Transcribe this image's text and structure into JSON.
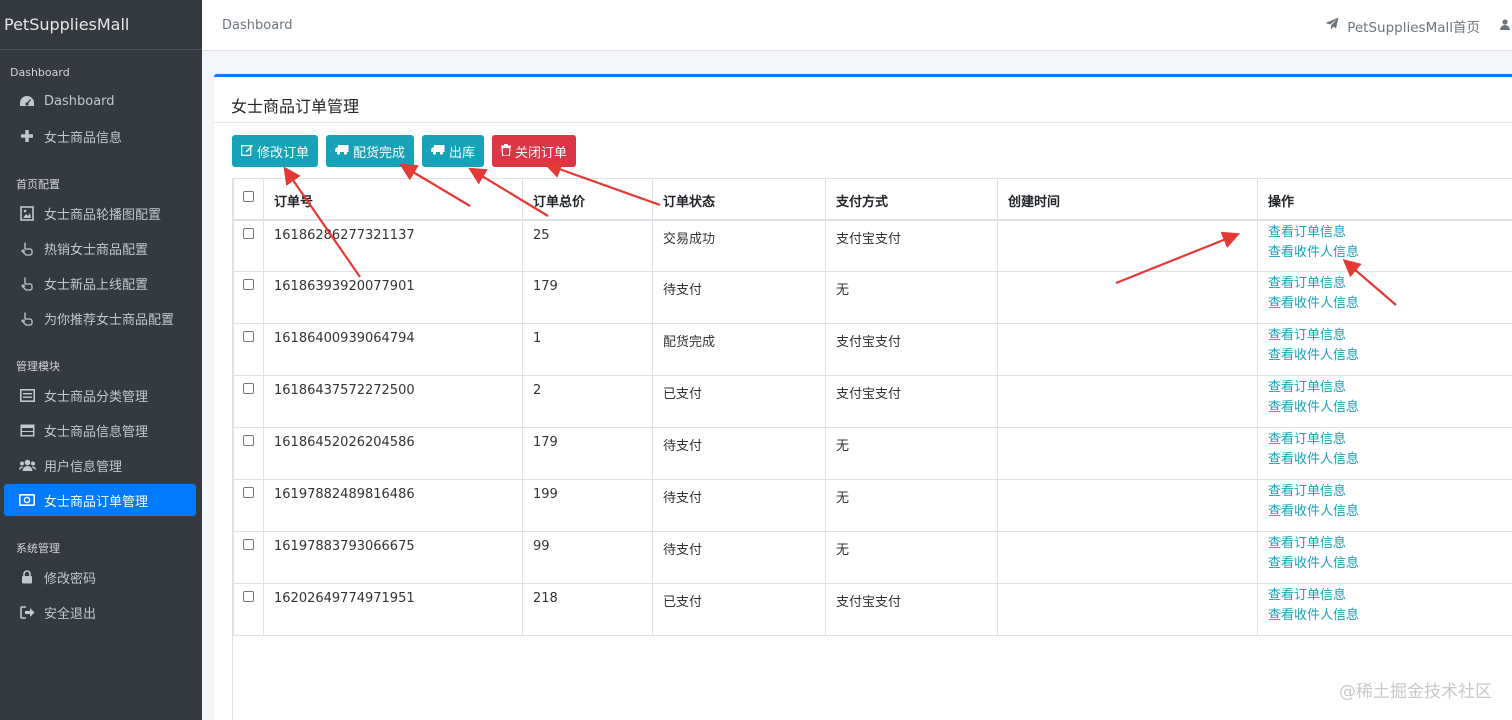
{
  "brand": "PetSuppliesMall",
  "sidebar": {
    "sections": [
      {
        "header": "Dashboard",
        "items": [
          {
            "label": "Dashboard",
            "icon": "tachometer-icon"
          },
          {
            "label": "女士商品信息",
            "icon": "plus-icon"
          }
        ]
      },
      {
        "header": "首页配置",
        "items": [
          {
            "label": "女士商品轮播图配置",
            "icon": "image-icon"
          },
          {
            "label": "热销女士商品配置",
            "icon": "hand-pointer-icon"
          },
          {
            "label": "女士新品上线配置",
            "icon": "hand-pointer-icon"
          },
          {
            "label": "为你推荐女士商品配置",
            "icon": "hand-pointer-icon"
          }
        ]
      },
      {
        "header": "管理模块",
        "items": [
          {
            "label": "女士商品分类管理",
            "icon": "list-alt-icon"
          },
          {
            "label": "女士商品信息管理",
            "icon": "table-icon"
          },
          {
            "label": "用户信息管理",
            "icon": "users-icon"
          },
          {
            "label": "女士商品订单管理",
            "icon": "money-bill-icon",
            "active": true
          }
        ]
      },
      {
        "header": "系统管理",
        "items": [
          {
            "label": "修改密码",
            "icon": "lock-icon"
          },
          {
            "label": "安全退出",
            "icon": "sign-out-icon"
          }
        ]
      }
    ]
  },
  "topbar": {
    "breadcrumb": "Dashboard",
    "home_link": "PetSuppliesMall首页"
  },
  "card": {
    "title": "女士商品订单管理",
    "buttons": {
      "edit": "修改订单",
      "delivered": "配货完成",
      "outbound": "出库",
      "close": "关闭订单"
    }
  },
  "table": {
    "headers": [
      "订单号",
      "订单总价",
      "订单状态",
      "支付方式",
      "创建时间",
      "操作"
    ],
    "op_view_order": "查看订单信息",
    "op_view_receiver": "查看收件人信息",
    "rows": [
      {
        "order_no": "16186286277321137",
        "total": "25",
        "status": "交易成功",
        "pay": "支付宝支付",
        "created": ""
      },
      {
        "order_no": "16186393920077901",
        "total": "179",
        "status": "待支付",
        "pay": "无",
        "created": ""
      },
      {
        "order_no": "16186400939064794",
        "total": "1",
        "status": "配货完成",
        "pay": "支付宝支付",
        "created": ""
      },
      {
        "order_no": "16186437572272500",
        "total": "2",
        "status": "已支付",
        "pay": "支付宝支付",
        "created": ""
      },
      {
        "order_no": "16186452026204586",
        "total": "179",
        "status": "待支付",
        "pay": "无",
        "created": ""
      },
      {
        "order_no": "16197882489816486",
        "total": "199",
        "status": "待支付",
        "pay": "无",
        "created": ""
      },
      {
        "order_no": "16197883793066675",
        "total": "99",
        "status": "待支付",
        "pay": "无",
        "created": ""
      },
      {
        "order_no": "16202649774971951",
        "total": "218",
        "status": "已支付",
        "pay": "支付宝支付",
        "created": ""
      }
    ]
  },
  "colors": {
    "sidebar_bg": "#343a40",
    "primary": "#007bff",
    "info": "#17a2b8",
    "danger": "#dc3545",
    "annotation_arrow": "#e53935"
  },
  "watermark": "@稀土掘金技术社区"
}
